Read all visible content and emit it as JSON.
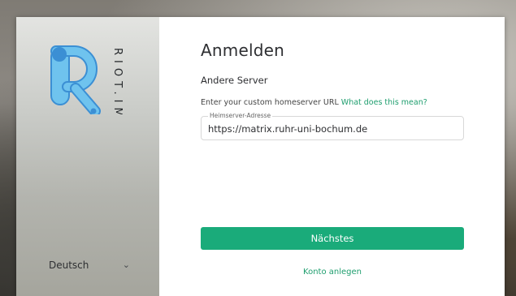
{
  "branding": {
    "logo_icon": "riot-r-logo",
    "wordmark": "RIOT.IM",
    "accent_color": "#1aab7a",
    "logo_color": "#6fc3ee",
    "logo_dark": "#3b8fd4"
  },
  "sidebar": {
    "language_selected": "Deutsch",
    "language_chevron_icon": "chevron-down-icon"
  },
  "main": {
    "title": "Anmelden",
    "server_label": "Andere Server",
    "hint_text": "Enter your custom homeserver URL ",
    "hint_link": "What does this mean?",
    "homeserver_field": {
      "label": "Heimserver-Adresse",
      "value": "https://matrix.ruhr-uni-bochum.de"
    },
    "next_button": "Nächstes",
    "create_account_link": "Konto anlegen"
  }
}
